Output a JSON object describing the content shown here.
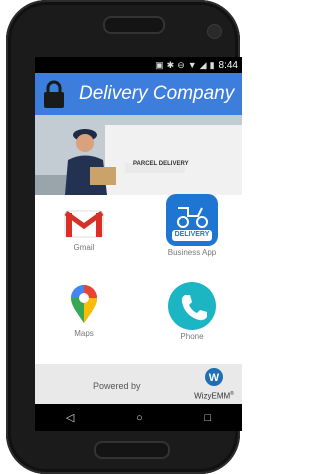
{
  "status_bar": {
    "time": "8:44",
    "icons": [
      "nfc-icon",
      "bluetooth-icon",
      "do-not-disturb-icon",
      "wifi-icon",
      "cell-signal-icon",
      "battery-icon"
    ]
  },
  "app_bar": {
    "title": "Delivery Company",
    "icon": "lock-icon",
    "color": "#3d7ddb"
  },
  "banner": {
    "van_text": "PARCEL DELIVERY"
  },
  "apps": [
    {
      "label": "Gmail",
      "icon": "gmail-icon"
    },
    {
      "label": "Business App",
      "icon": "delivery-scooter-icon",
      "badge": "DELIVERY"
    },
    {
      "label": "Maps",
      "icon": "maps-pin-icon"
    },
    {
      "label": "Phone",
      "icon": "phone-icon"
    }
  ],
  "footer": {
    "powered_by": "Powered by",
    "brand": "WizyEMM",
    "brand_sup": "®",
    "logo_letter": "W"
  },
  "nav": {
    "back": "◁",
    "home": "○",
    "recents": "□"
  }
}
